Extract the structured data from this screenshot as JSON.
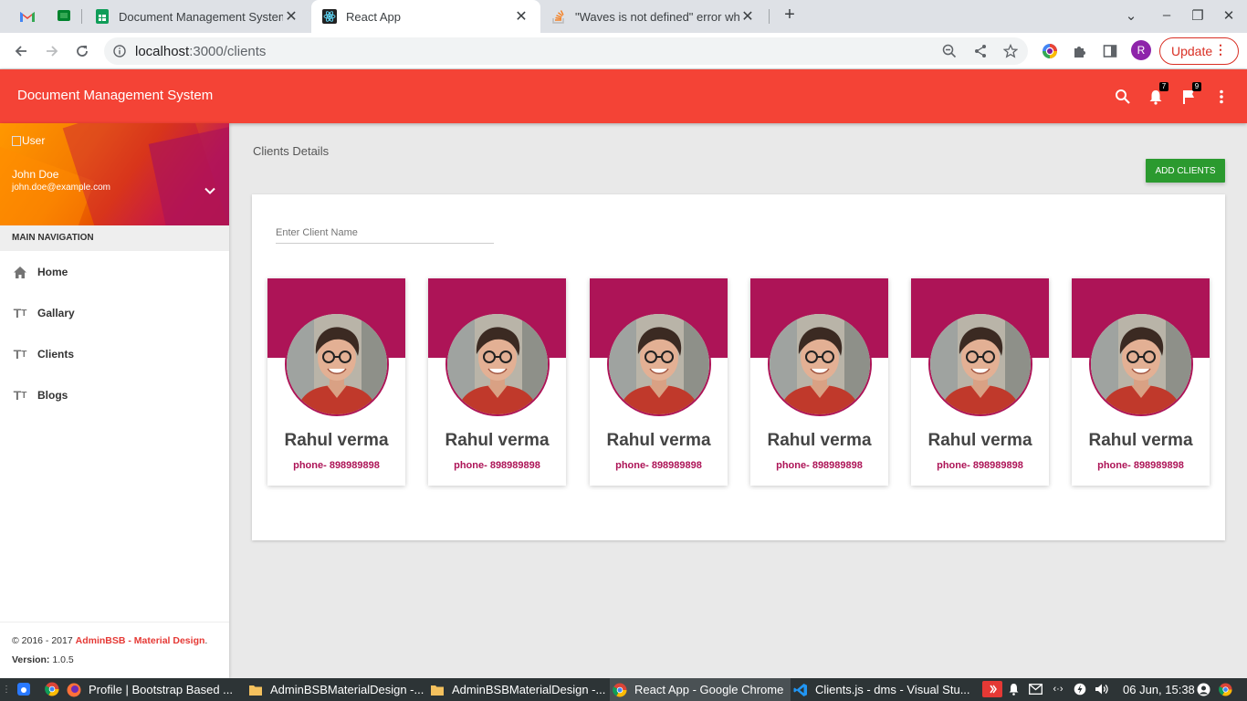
{
  "browser": {
    "tabs": [
      {
        "title": "Document Management System",
        "icon": "google-sheets-icon"
      },
      {
        "title": "React App",
        "icon": "react-icon",
        "active": true
      },
      {
        "title": "\"Waves is not defined\" error wh",
        "icon": "stackoverflow-icon"
      }
    ],
    "url_host": "localhost",
    "url_path": ":3000/clients",
    "update_label": "Update",
    "profile_initial": "R"
  },
  "app": {
    "brand": "Document Management System",
    "notifications_count": "7",
    "flags_count": "9"
  },
  "sidebar": {
    "user_img_alt": "User",
    "user_name": "John Doe",
    "user_email": "john.doe@example.com",
    "nav_header": "MAIN NAVIGATION",
    "items": [
      {
        "label": "Home",
        "icon": "home-icon"
      },
      {
        "label": "Gallary",
        "icon": "text-fields-icon"
      },
      {
        "label": "Clients",
        "icon": "text-fields-icon"
      },
      {
        "label": "Blogs",
        "icon": "text-fields-icon"
      }
    ],
    "footer_copyright": "© 2016 - 2017 ",
    "footer_brand": "AdminBSB - Material Design",
    "footer_dot": ".",
    "footer_version_label": "Version: ",
    "footer_version": "1.0.5"
  },
  "main": {
    "title": "Clients Details",
    "add_button": "ADD CLIENTS",
    "search_placeholder": "Enter Client Name",
    "clients": [
      {
        "name": "Rahul verma",
        "phone": "phone- 898989898"
      },
      {
        "name": "Rahul verma",
        "phone": "phone- 898989898"
      },
      {
        "name": "Rahul verma",
        "phone": "phone- 898989898"
      },
      {
        "name": "Rahul verma",
        "phone": "phone- 898989898"
      },
      {
        "name": "Rahul verma",
        "phone": "phone- 898989898"
      },
      {
        "name": "Rahul verma",
        "phone": "phone- 898989898"
      }
    ]
  },
  "taskbar": {
    "items": [
      {
        "label": "Profile | Bootstrap Based ...",
        "icon": "firefox-icon"
      },
      {
        "label": "AdminBSBMaterialDesign -...",
        "icon": "folder-icon"
      },
      {
        "label": "AdminBSBMaterialDesign -...",
        "icon": "folder-icon"
      },
      {
        "label": "React App - Google Chrome",
        "icon": "chrome-icon"
      },
      {
        "label": "Clients.js - dms - Visual Stu...",
        "icon": "vscode-icon"
      }
    ],
    "clock": "06 Jun, 15:38"
  },
  "colors": {
    "app_bar": "#f44336",
    "card_accent": "#ad1457",
    "add_button": "#2b9a2f"
  }
}
